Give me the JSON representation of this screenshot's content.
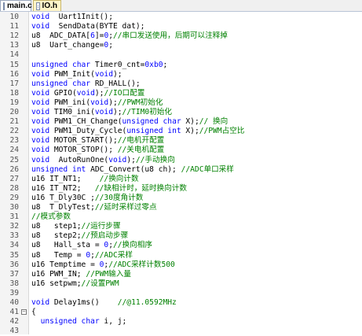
{
  "tabs": [
    {
      "label": "main.c",
      "active": true
    },
    {
      "label": "IO.h",
      "active": false
    }
  ],
  "lines": [
    {
      "n": "10",
      "segs": [
        [
          "kw",
          "void"
        ],
        [
          "",
          "  Uart1Init();"
        ]
      ]
    },
    {
      "n": "11",
      "segs": [
        [
          "kw",
          "void"
        ],
        [
          "",
          "  SendData(BYTE dat);"
        ]
      ]
    },
    {
      "n": "12",
      "segs": [
        [
          "",
          "u8  ADC_DATA["
        ],
        [
          "nm",
          "6"
        ],
        [
          "",
          "]="
        ],
        [
          "nm",
          "0"
        ],
        [
          "",
          ";"
        ],
        [
          "cm",
          "//串口发送使用，后期可以注释掉"
        ]
      ]
    },
    {
      "n": "13",
      "segs": [
        [
          "",
          "u8  Uart_change="
        ],
        [
          "nm",
          "0"
        ],
        [
          "",
          ";"
        ]
      ]
    },
    {
      "n": "14",
      "segs": []
    },
    {
      "n": "15",
      "segs": [
        [
          "kw",
          "unsigned char"
        ],
        [
          "",
          " Timer0_cnt="
        ],
        [
          "nm",
          "0xb0"
        ],
        [
          "",
          ";"
        ]
      ]
    },
    {
      "n": "16",
      "segs": [
        [
          "kw",
          "void"
        ],
        [
          "",
          " PWM_Init("
        ],
        [
          "kw",
          "void"
        ],
        [
          "",
          ");"
        ]
      ]
    },
    {
      "n": "17",
      "segs": [
        [
          "kw",
          "unsigned char"
        ],
        [
          "",
          " RD_HALL();"
        ]
      ]
    },
    {
      "n": "18",
      "segs": [
        [
          "kw",
          "void"
        ],
        [
          "",
          " GPIO("
        ],
        [
          "kw",
          "void"
        ],
        [
          "",
          ");"
        ],
        [
          "cm",
          "//IO口配置"
        ]
      ]
    },
    {
      "n": "19",
      "segs": [
        [
          "kw",
          "void"
        ],
        [
          "",
          " PWM_ini("
        ],
        [
          "kw",
          "void"
        ],
        [
          "",
          ");"
        ],
        [
          "cm",
          "//PWM初始化"
        ]
      ]
    },
    {
      "n": "20",
      "segs": [
        [
          "kw",
          "void"
        ],
        [
          "",
          " TIM0_ini("
        ],
        [
          "kw",
          "void"
        ],
        [
          "",
          ");"
        ],
        [
          "cm",
          "//TIM0初始化"
        ]
      ]
    },
    {
      "n": "21",
      "segs": [
        [
          "kw",
          "void"
        ],
        [
          "",
          " PWM1_CH_Change("
        ],
        [
          "kw",
          "unsigned char"
        ],
        [
          "",
          " X);"
        ],
        [
          "cm",
          "// 换向"
        ]
      ]
    },
    {
      "n": "22",
      "segs": [
        [
          "kw",
          "void"
        ],
        [
          "",
          " PWM1_Duty_Cycle("
        ],
        [
          "kw",
          "unsigned int"
        ],
        [
          "",
          " X);"
        ],
        [
          "cm",
          "//PWM占空比"
        ]
      ]
    },
    {
      "n": "23",
      "segs": [
        [
          "kw",
          "void"
        ],
        [
          "",
          " MOTOR_START();"
        ],
        [
          "cm",
          "//电机开配置"
        ]
      ]
    },
    {
      "n": "24",
      "segs": [
        [
          "kw",
          "void"
        ],
        [
          "",
          " MOTOR_STOP();"
        ],
        [
          "cm",
          " //关电机配置"
        ]
      ]
    },
    {
      "n": "25",
      "segs": [
        [
          "kw",
          "void"
        ],
        [
          "",
          "  AutoRunOne("
        ],
        [
          "kw",
          "void"
        ],
        [
          "",
          ");"
        ],
        [
          "cm",
          "//手动换向"
        ]
      ]
    },
    {
      "n": "26",
      "segs": [
        [
          "kw",
          "unsigned int"
        ],
        [
          "",
          " ADC_Convert(u8 ch); "
        ],
        [
          "cm",
          "//ADC单口采样"
        ]
      ]
    },
    {
      "n": "27",
      "segs": [
        [
          "",
          "u16 IT_NT1;    "
        ],
        [
          "cm",
          "//换向计数"
        ]
      ]
    },
    {
      "n": "28",
      "segs": [
        [
          "",
          "u16 IT_NT2;   "
        ],
        [
          "cm",
          "//缺相计时，延时换向计数"
        ]
      ]
    },
    {
      "n": "29",
      "segs": [
        [
          "",
          "u16 T_Dly30C ;"
        ],
        [
          "cm",
          "//30度角计数"
        ]
      ]
    },
    {
      "n": "30",
      "segs": [
        [
          "",
          "u8  T_DlyTest;"
        ],
        [
          "cm",
          "//延时采样过零点"
        ]
      ]
    },
    {
      "n": "31",
      "segs": [
        [
          "cm",
          "//模式参数"
        ]
      ]
    },
    {
      "n": "32",
      "segs": [
        [
          "",
          "u8   step1;"
        ],
        [
          "cm",
          "//运行步骤"
        ]
      ]
    },
    {
      "n": "33",
      "segs": [
        [
          "",
          "u8   step2;"
        ],
        [
          "cm",
          "//预启动步骤"
        ]
      ]
    },
    {
      "n": "34",
      "segs": [
        [
          "",
          "u8   Hall_sta = "
        ],
        [
          "nm",
          "0"
        ],
        [
          "",
          ";"
        ],
        [
          "cm",
          "//换向相序"
        ]
      ]
    },
    {
      "n": "35",
      "segs": [
        [
          "",
          "u8   Temp = "
        ],
        [
          "nm",
          "0"
        ],
        [
          "",
          ";"
        ],
        [
          "cm",
          "//ADC采样"
        ]
      ]
    },
    {
      "n": "36",
      "segs": [
        [
          "",
          "u16 Temptime = "
        ],
        [
          "nm",
          "0"
        ],
        [
          "",
          ";"
        ],
        [
          "cm",
          "//ADC采样计数500"
        ]
      ]
    },
    {
      "n": "37",
      "segs": [
        [
          "",
          "u16 PWM_IN; "
        ],
        [
          "cm",
          "//PWM输入量"
        ]
      ]
    },
    {
      "n": "38",
      "segs": [
        [
          "",
          "u16 setpwm;"
        ],
        [
          "cm",
          "//设置PWM"
        ]
      ]
    },
    {
      "n": "39",
      "segs": []
    },
    {
      "n": "40",
      "segs": [
        [
          "kw",
          "void"
        ],
        [
          "",
          " Delay1ms()    "
        ],
        [
          "cm",
          "//@11.0592MHz"
        ]
      ]
    },
    {
      "n": "41",
      "fold": "−",
      "segs": [
        [
          "",
          "{"
        ]
      ]
    },
    {
      "n": "42",
      "segs": [
        [
          "",
          "  "
        ],
        [
          "kw",
          "unsigned char"
        ],
        [
          "",
          " i, j;"
        ]
      ]
    },
    {
      "n": "43",
      "segs": []
    }
  ]
}
